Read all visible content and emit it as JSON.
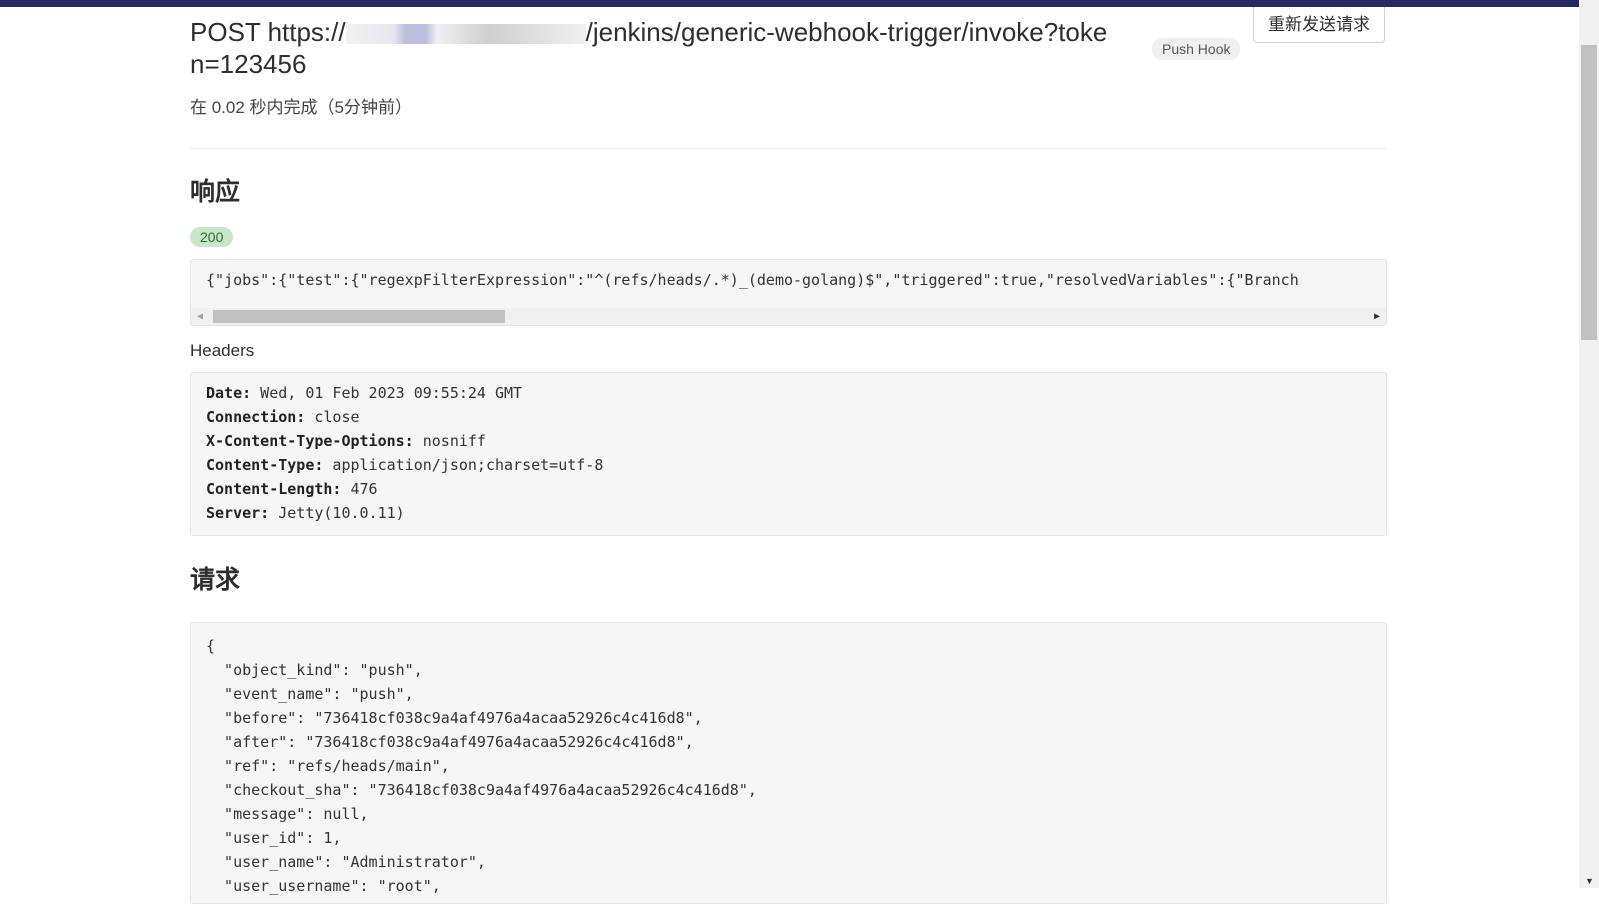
{
  "request": {
    "method": "POST",
    "url_prefix": "https://",
    "url_suffix": "/jenkins/generic-webhook-trigger/invoke?token=123456",
    "hook_type": "Push Hook",
    "resend_label": "重新发送请求",
    "completed_text": "在 0.02 秒内完成（5分钟前）"
  },
  "response": {
    "heading": "响应",
    "status_code": "200",
    "body": "{\"jobs\":{\"test\":{\"regexpFilterExpression\":\"^(refs/heads/.*)_(demo-golang)$\",\"triggered\":true,\"resolvedVariables\":{\"Branch",
    "headers_label": "Headers",
    "headers": [
      {
        "name": "Date:",
        "value": " Wed, 01 Feb 2023 09:55:24 GMT"
      },
      {
        "name": "Connection:",
        "value": " close"
      },
      {
        "name": "X-Content-Type-Options:",
        "value": " nosniff"
      },
      {
        "name": "Content-Type:",
        "value": " application/json;charset=utf-8"
      },
      {
        "name": "Content-Length:",
        "value": " 476"
      },
      {
        "name": "Server:",
        "value": " Jetty(10.0.11)"
      }
    ]
  },
  "request_section": {
    "heading": "请求",
    "body_lines": [
      "{",
      "  \"object_kind\": \"push\",",
      "  \"event_name\": \"push\",",
      "  \"before\": \"736418cf038c9a4af4976a4acaa52926c4c416d8\",",
      "  \"after\": \"736418cf038c9a4af4976a4acaa52926c4c416d8\",",
      "  \"ref\": \"refs/heads/main\",",
      "  \"checkout_sha\": \"736418cf038c9a4af4976a4acaa52926c4c416d8\",",
      "  \"message\": null,",
      "  \"user_id\": 1,",
      "  \"user_name\": \"Administrator\",",
      "  \"user_username\": \"root\","
    ]
  },
  "icons": {
    "scroll_left": "arrow-left-icon",
    "scroll_right": "arrow-right-icon",
    "scroll_down": "arrow-down-icon"
  },
  "colors": {
    "topbar": "#292961",
    "status_badge_bg": "#c8e6c9",
    "code_bg": "#f6f6f6"
  }
}
